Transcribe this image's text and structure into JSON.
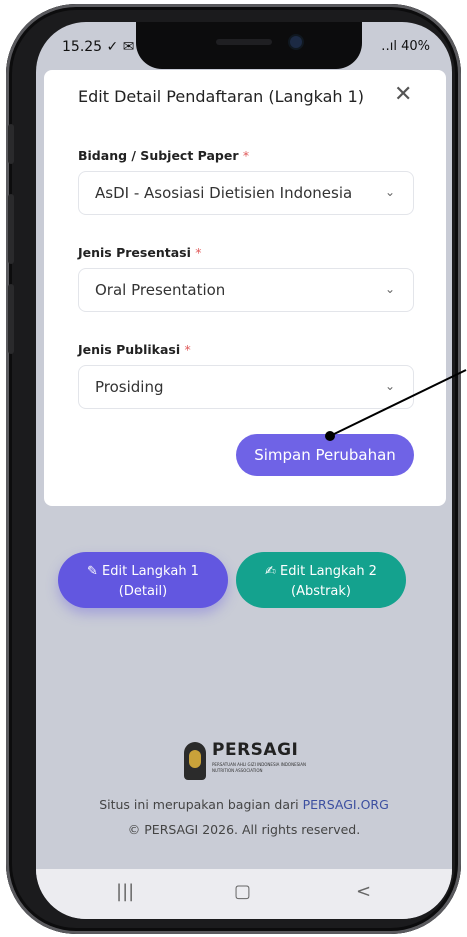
{
  "status": {
    "time": "15.25",
    "left_icons": "✓ ✉",
    "right": "‥ıl 40%"
  },
  "modal": {
    "title": "Edit Detail Pendaftaran (Langkah 1)",
    "close_glyph": "✕",
    "fields": [
      {
        "label": "Bidang / Subject Paper",
        "required": "*",
        "value": "AsDI - Asosiasi Dietisien Indonesia"
      },
      {
        "label": "Jenis Presentasi",
        "required": "*",
        "value": "Oral Presentation"
      },
      {
        "label": "Jenis Publikasi",
        "required": "*",
        "value": "Prosiding"
      }
    ],
    "save_label": "Simpan Perubahan"
  },
  "actions": {
    "step1_line1": "✎ Edit Langkah 1",
    "step1_line2": "(Detail)",
    "step2_line1": "✍ Edit Langkah 2",
    "step2_line2": "(Abstrak)"
  },
  "footer": {
    "logo_name": "PERSAGI",
    "logo_sub": "PERSATUAN AHLI GIZI INDONESIA INDONESIAN NUTRITION ASSOCIATION",
    "text_prefix": "Situs ini merupakan bagian dari ",
    "link_text": "PERSAGI.ORG",
    "copyright": "© PERSAGI 2026. All rights reserved."
  },
  "navbar": {
    "recent": "|||",
    "home": "▢",
    "back": "<"
  },
  "colors": {
    "primary": "#6f63e6",
    "teal": "#14a28e",
    "backdrop": "#c9ccd6"
  }
}
